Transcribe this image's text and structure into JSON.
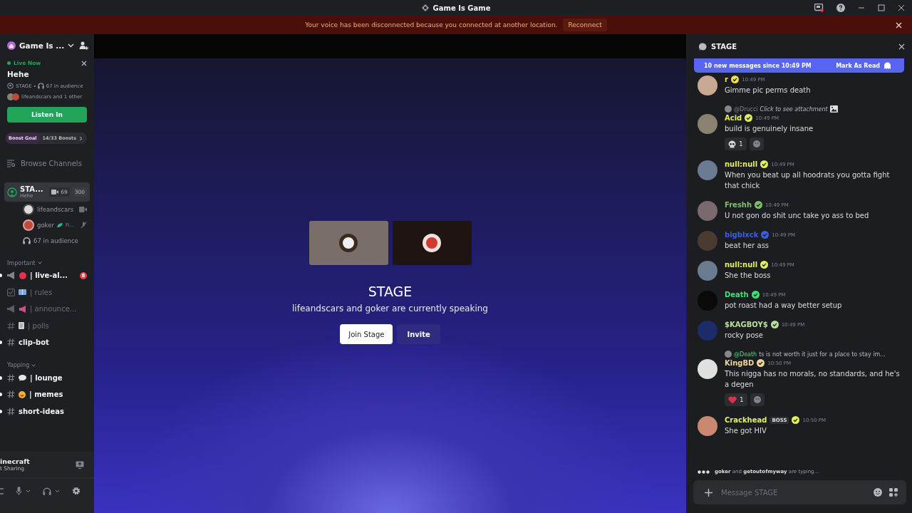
{
  "window": {
    "title": "Game Is Game"
  },
  "banner": {
    "text": "Your voice has been disconnected because you connected at another location.",
    "action": "Reconnect"
  },
  "server": {
    "name": "Game Is ..."
  },
  "live": {
    "badge": "Live Now",
    "title": "Hehe",
    "channel": "STAGE",
    "audience": "67 in audience",
    "speakers": "lifeandscars and 1 other",
    "button": "Listen In"
  },
  "boost": {
    "label": "Boost Goal",
    "progress": "14/33 Boosts",
    "level": 0.42
  },
  "browse": "Browse Channels",
  "stage_channel": {
    "name": "STA...",
    "topic": "Hehe",
    "video_count": "69",
    "limit": "300",
    "selected": true,
    "members": [
      {
        "name": "lifeandscars",
        "video": true
      },
      {
        "name": "goker",
        "tag": "Fi...",
        "video": false
      }
    ],
    "audience": "67 in audience"
  },
  "categories": [
    {
      "name": "Important",
      "channels": [
        {
          "kind": "announcement",
          "emoji": {
            "kind": "circle"
          },
          "name": "| live-al...",
          "unread": true,
          "muted": false,
          "badge": "8"
        },
        {
          "kind": "rules",
          "emoji": {
            "kind": "book"
          },
          "name": "| rules",
          "unread": false,
          "muted": true
        },
        {
          "kind": "announcement",
          "emoji": {
            "kind": "megaphone"
          },
          "name": "| announce...",
          "unread": false,
          "muted": true
        },
        {
          "kind": "text",
          "emoji": {
            "kind": "page"
          },
          "name": "| polls",
          "unread": false,
          "muted": true
        },
        {
          "kind": "text",
          "name": "clip-bot",
          "unread": true,
          "muted": false
        }
      ]
    },
    {
      "name": "Yapping",
      "channels": [
        {
          "kind": "text",
          "emoji": {
            "kind": "speech"
          },
          "name": "| lounge",
          "unread": true,
          "muted": false
        },
        {
          "kind": "text",
          "emoji": {
            "kind": "grin"
          },
          "name": "| memes",
          "unread": true,
          "muted": false
        },
        {
          "kind": "text",
          "name": "short-ideas",
          "unread": true,
          "muted": false
        }
      ]
    }
  ],
  "activity": {
    "title": "inecraft",
    "subtitle": "t Sharing"
  },
  "stage": {
    "title": "STAGE",
    "subtitle": "lifeandscars and goker are currently speaking",
    "primary": "Join Stage",
    "secondary": "Invite"
  },
  "chat": {
    "title": "STAGE",
    "new_messages": "10 new messages since 10:49 PM",
    "mark_read": "Mark As Read",
    "placeholder": "Message STAGE",
    "typing": {
      "users": [
        "goker",
        "getoutofmyway"
      ],
      "joiner": "and",
      "suffix": "are typing..."
    },
    "messages": [
      {
        "author": "r",
        "color": "#f0e04a",
        "time": "10:49 PM",
        "text": "Gimme pic perms death"
      },
      {
        "author": "Acid",
        "color": "#e3f05a",
        "time": "10:49 PM",
        "text": "build is genuinely insane",
        "reply": {
          "author": "@Drucci",
          "text": "Click to see attachment",
          "attachment": true
        },
        "reactions": [
          {
            "kind": "skull",
            "count": "1"
          }
        ]
      },
      {
        "author": "null:null",
        "color": "#e3f05a",
        "time": "10:49 PM",
        "text": "When you beat up all hoodrats you gotta fight that chick"
      },
      {
        "author": "Freshh",
        "color": "#7fbf6a",
        "time": "10:49 PM",
        "text": "U not gon do shit unc take yo ass to bed"
      },
      {
        "author": "bigblxck",
        "color": "#3b5fe0",
        "time": "10:49 PM",
        "text": "beat her ass"
      },
      {
        "author": "null:null",
        "color": "#e3f05a",
        "time": "10:49 PM",
        "text": "She the boss"
      },
      {
        "author": "Death",
        "color": "#3ee07a",
        "time": "10:49 PM",
        "text": "pot roast had a way better setup"
      },
      {
        "author": "$KAGBOY$",
        "color": "#b9e09a",
        "time": "10:49 PM",
        "text": "rocky pose"
      },
      {
        "author": "KingBD",
        "color": "#f0d49a",
        "time": "10:50 PM",
        "text": "This nigga has no morals, no standards, and he's a degen",
        "reply": {
          "author": "@Death",
          "text": "ts is not worth it just for a place to stay im...",
          "attachment": false
        },
        "reactions": [
          {
            "kind": "heart",
            "count": "1"
          }
        ]
      },
      {
        "author": "Crackhead",
        "color": "#e3f05a",
        "time": "10:50 PM",
        "tag": "BOSS",
        "text": "She got HIV"
      }
    ]
  }
}
